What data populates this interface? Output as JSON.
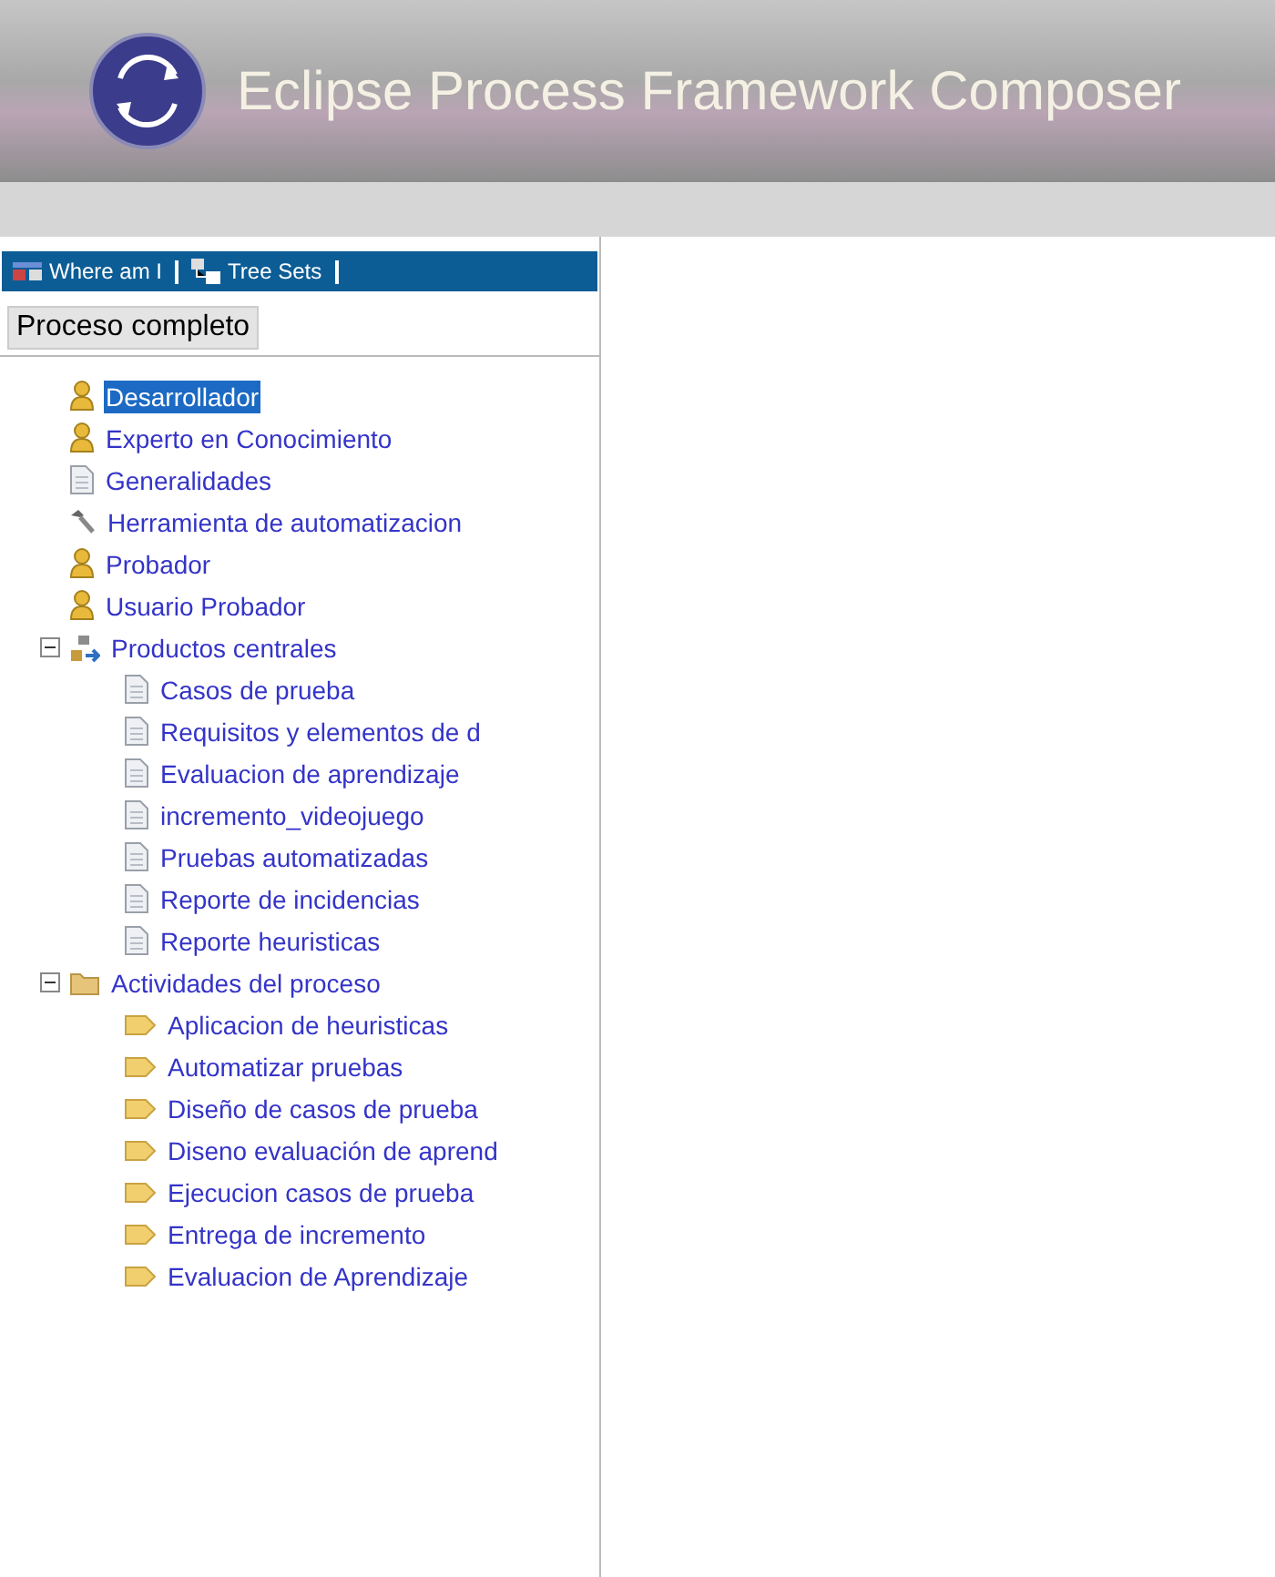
{
  "header": {
    "title": "Eclipse Process Framework Composer"
  },
  "toolbar": {
    "items": [
      {
        "label": "Where am I",
        "kind": "where"
      },
      {
        "label": "Tree Sets",
        "kind": "sets"
      }
    ]
  },
  "view_tab": {
    "label": "Proceso completo"
  },
  "tree": [
    {
      "label": "Desarrollador",
      "kind": "role",
      "selected": true
    },
    {
      "label": "Experto en Conocimiento",
      "kind": "role",
      "selected": false
    },
    {
      "label": "Generalidades",
      "kind": "doc",
      "selected": false
    },
    {
      "label": "Herramienta de automatizacion",
      "kind": "tool",
      "selected": false
    },
    {
      "label": "Probador",
      "kind": "role",
      "selected": false
    },
    {
      "label": "Usuario Probador",
      "kind": "role",
      "selected": false
    },
    {
      "label": "Productos centrales",
      "kind": "domain",
      "selected": false,
      "expanded": true,
      "children": [
        {
          "label": "Casos de prueba",
          "kind": "doc",
          "selected": false
        },
        {
          "label": "Requisitos y elementos de d",
          "kind": "doc",
          "selected": false
        },
        {
          "label": "Evaluacion de aprendizaje",
          "kind": "doc",
          "selected": false
        },
        {
          "label": "incremento_videojuego",
          "kind": "doc",
          "selected": false
        },
        {
          "label": "Pruebas automatizadas",
          "kind": "doc",
          "selected": false
        },
        {
          "label": "Reporte de incidencias",
          "kind": "doc",
          "selected": false
        },
        {
          "label": "Reporte heuristicas",
          "kind": "doc",
          "selected": false
        }
      ]
    },
    {
      "label": "Actividades del proceso",
      "kind": "folder",
      "selected": false,
      "expanded": true,
      "children": [
        {
          "label": "Aplicacion de heuristicas",
          "kind": "activity",
          "selected": false
        },
        {
          "label": "Automatizar pruebas",
          "kind": "activity",
          "selected": false
        },
        {
          "label": "Diseño de casos de prueba",
          "kind": "activity",
          "selected": false
        },
        {
          "label": "Diseno evaluación de aprend",
          "kind": "activity",
          "selected": false
        },
        {
          "label": "Ejecucion casos de prueba",
          "kind": "activity",
          "selected": false
        },
        {
          "label": "Entrega de incremento",
          "kind": "activity",
          "selected": false
        },
        {
          "label": "Evaluacion de Aprendizaje",
          "kind": "activity",
          "selected": false
        }
      ]
    }
  ]
}
